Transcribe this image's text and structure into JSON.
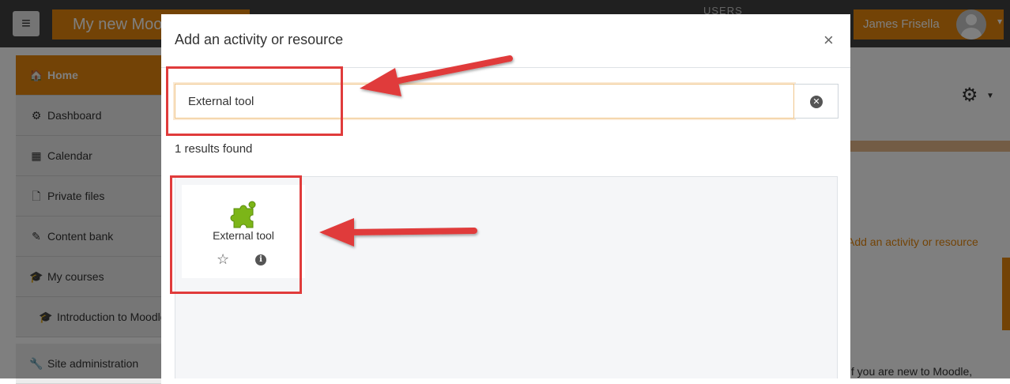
{
  "topbar": {
    "menu_icon": "hamburger-icon",
    "site_name": "My new Moodle site",
    "users_label": "USERS",
    "user_name": "James Frisella",
    "avatar_icon": "user-avatar-icon",
    "user_menu_caret": "▾"
  },
  "sidebar": {
    "items": [
      {
        "label": "Home",
        "icon": "home-icon",
        "glyph": "🏠",
        "active": true
      },
      {
        "label": "Dashboard",
        "icon": "dashboard-icon",
        "glyph": "⚙"
      },
      {
        "label": "Calendar",
        "icon": "calendar-icon",
        "glyph": "▦"
      },
      {
        "label": "Private files",
        "icon": "file-icon",
        "glyph": "🗋"
      },
      {
        "label": "Content bank",
        "icon": "paintbrush-icon",
        "glyph": "✎"
      },
      {
        "label": "My courses",
        "icon": "graduation-cap-icon",
        "glyph": "🎓"
      },
      {
        "label": "Introduction to Moodle",
        "icon": "graduation-cap-icon",
        "glyph": "🎓"
      },
      {
        "label": "Site administration",
        "icon": "wrench-icon",
        "glyph": "🔧"
      }
    ]
  },
  "page": {
    "settings_icon": "gear-icon",
    "add_activity_link": "Add an activity or resource",
    "intro_text_fragment": "If you are new to Moodle,"
  },
  "modal": {
    "title": "Add an activity or resource",
    "close_glyph": "×",
    "search": {
      "value": "External tool",
      "placeholder": "Search",
      "clear_icon": "clear-search-icon"
    },
    "results_count": "1 results found",
    "results": [
      {
        "name": "External tool",
        "icon": "puzzle-piece-icon",
        "star_icon": "star-icon",
        "info_icon": "info-icon"
      }
    ]
  },
  "colors": {
    "brand_orange": "#e6870c",
    "navbar": "#414141",
    "annotation_red": "#e03b3b",
    "plugin_green": "#7cb518"
  }
}
